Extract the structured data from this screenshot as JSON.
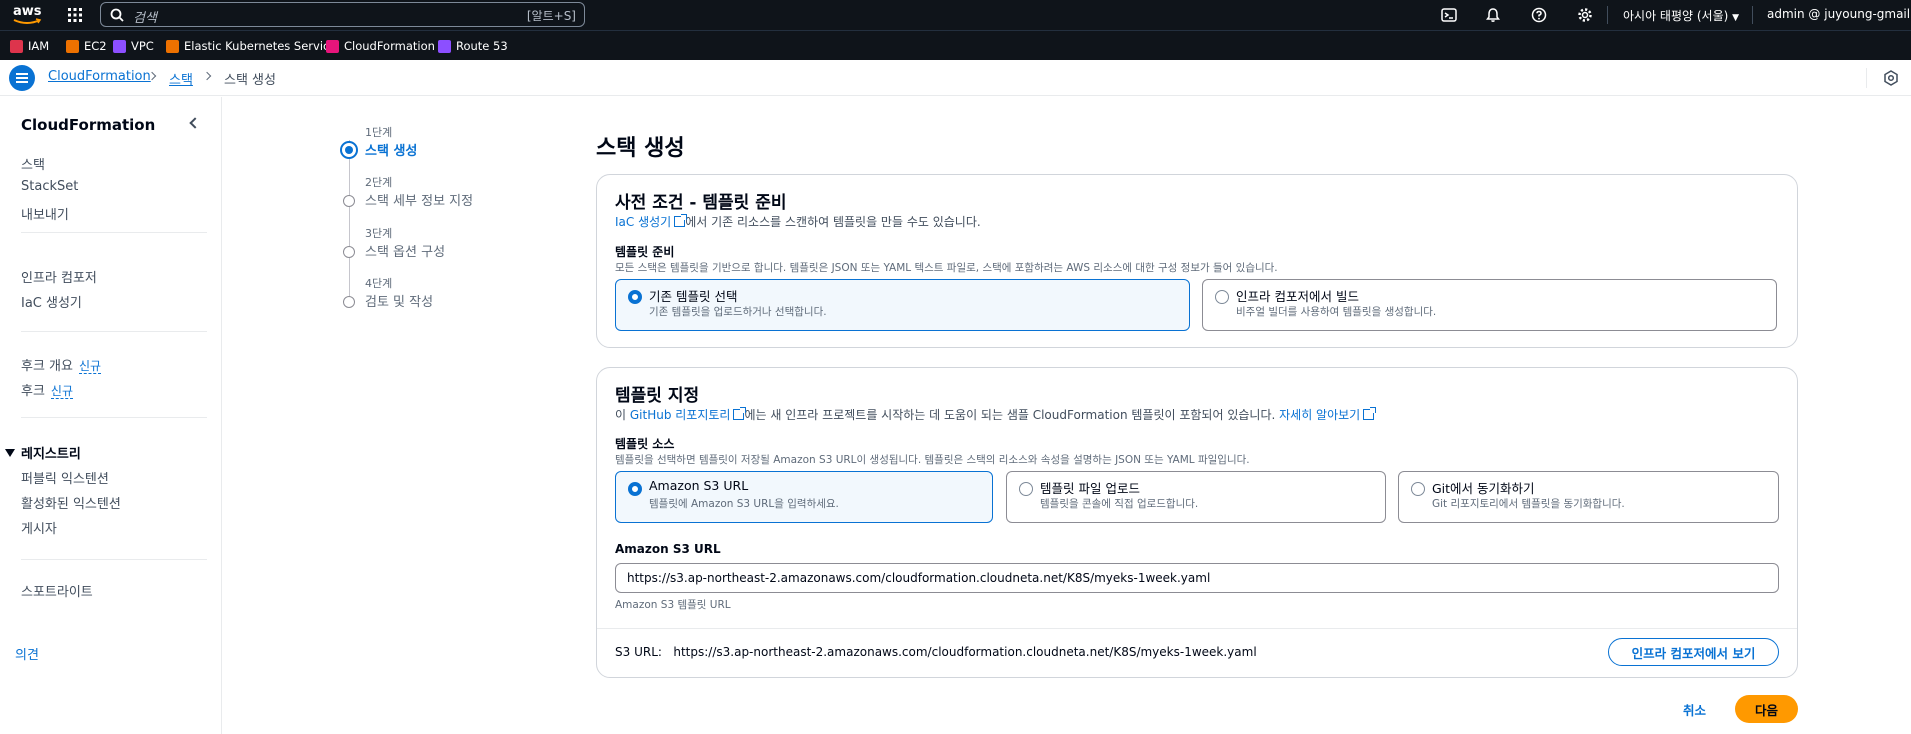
{
  "topnav": {
    "logo_text": "aws",
    "search_placeholder": "검색",
    "search_shortcut": "[알트+S]",
    "region": "아시아 태평양 (서울)",
    "account": "admin @ juyoung-gmail"
  },
  "favorites": [
    {
      "label": "IAM",
      "color": "#dd344c"
    },
    {
      "label": "EC2",
      "color": "#ed7100"
    },
    {
      "label": "VPC",
      "color": "#8c4fff"
    },
    {
      "label": "Elastic Kubernetes Service",
      "color": "#ed7100"
    },
    {
      "label": "CloudFormation",
      "color": "#e7157b"
    },
    {
      "label": "Route 53",
      "color": "#8c4fff"
    }
  ],
  "breadcrumb": {
    "items": [
      "CloudFormation",
      "스택",
      "스택 생성"
    ]
  },
  "sidebar": {
    "title": "CloudFormation",
    "items": [
      "스택",
      "StackSet",
      "내보내기"
    ],
    "items2": [
      "인프라 컴포저",
      "IaC 생성기"
    ],
    "hooks_overview": "후크 개요",
    "hooks": "후크",
    "new_badge": "신규",
    "registry_title": "레지스트리",
    "registry_items": [
      "퍼블릭 익스텐션",
      "활성화된 익스텐션",
      "게시자"
    ],
    "spotlight": "스포트라이트",
    "feedback": "의견"
  },
  "steps": [
    {
      "num": "1단계",
      "label": "스택 생성",
      "active": true
    },
    {
      "num": "2단계",
      "label": "스택 세부 정보 지정",
      "active": false
    },
    {
      "num": "3단계",
      "label": "스택 옵션 구성",
      "active": false
    },
    {
      "num": "4단계",
      "label": "검토 및 작성",
      "active": false
    }
  ],
  "main": {
    "title": "스택 생성",
    "prereq": {
      "title": "사전 조건 - 템플릿 준비",
      "desc_link": "IaC 생성기",
      "desc_rest": "에서 기존 리소스를 스캔하여 템플릿을 만들 수도 있습니다.",
      "field_label": "템플릿 준비",
      "field_hint": "모든 스택은 템플릿을 기반으로 합니다. 템플릿은 JSON 또는 YAML 텍스트 파일로, 스택에 포함하려는 AWS 리소스에 대한 구성 정보가 들어 있습니다.",
      "options": [
        {
          "title": "기존 템플릿 선택",
          "desc": "기존 템플릿을 업로드하거나 선택합니다.",
          "selected": true
        },
        {
          "title": "인프라 컴포저에서 빌드",
          "desc": "비주얼 빌더를 사용하여 템플릿을 생성합니다.",
          "selected": false
        }
      ]
    },
    "template": {
      "title": "템플릿 지정",
      "desc_prefix": "이 ",
      "desc_link1": "GitHub 리포지토리",
      "desc_mid": "에는 새 인프라 프로젝트를 시작하는 데 도움이 되는 샘플 CloudFormation 템플릿이 포함되어 있습니다. ",
      "desc_link2": "자세히 알아보기",
      "source_label": "템플릿 소스",
      "source_hint": "템플릿을 선택하면 템플릿이 저장될 Amazon S3 URL이 생성됩니다. 템플릿은 스택의 리소스와 속성을 설명하는 JSON 또는 YAML 파일입니다.",
      "sources": [
        {
          "title": "Amazon S3 URL",
          "desc": "템플릿에 Amazon S3 URL을 입력하세요.",
          "selected": true
        },
        {
          "title": "템플릿 파일 업로드",
          "desc": "템플릿을 콘솔에 직접 업로드합니다.",
          "selected": false
        },
        {
          "title": "Git에서 동기화하기",
          "desc": "Git 리포지토리에서 템플릿을 동기화합니다.",
          "selected": false
        }
      ],
      "url_label": "Amazon S3 URL",
      "url_value": "https://s3.ap-northeast-2.amazonaws.com/cloudformation.cloudneta.net/K8S/myeks-1week.yaml",
      "url_hint": "Amazon S3 템플릿 URL",
      "s3_prefix": "S3 URL:",
      "s3_value": "https://s3.ap-northeast-2.amazonaws.com/cloudformation.cloudneta.net/K8S/myeks-1week.yaml",
      "view_button": "인프라 컴포저에서 보기"
    },
    "cancel": "취소",
    "next": "다음"
  },
  "colors": {
    "primary": "#0972d3",
    "accent": "#ff9900",
    "nav_bg": "#0f141a"
  }
}
